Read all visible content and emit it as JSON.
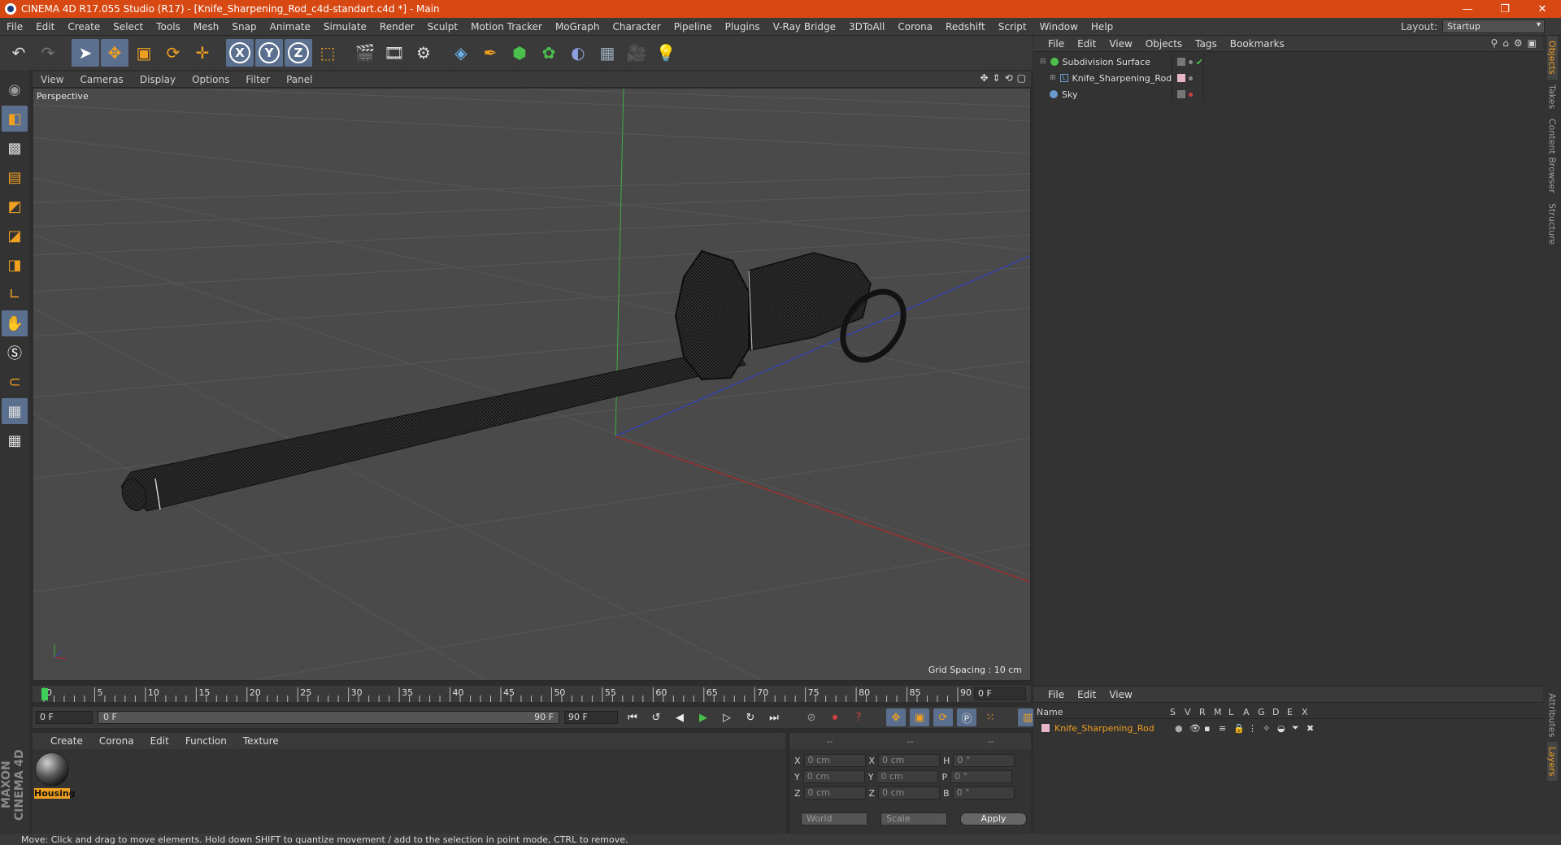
{
  "window": {
    "title": "CINEMA 4D R17.055 Studio (R17) - [Knife_Sharpening_Rod_c4d-standart.c4d *] - Main",
    "minimize": "—",
    "restore": "❐",
    "close": "✕"
  },
  "menu": {
    "items": [
      "File",
      "Edit",
      "Create",
      "Select",
      "Tools",
      "Mesh",
      "Snap",
      "Animate",
      "Simulate",
      "Render",
      "Sculpt",
      "Motion Tracker",
      "MoGraph",
      "Character",
      "Pipeline",
      "Plugins",
      "V-Ray Bridge",
      "3DToAll",
      "Corona",
      "Redshift",
      "Script",
      "Window",
      "Help"
    ],
    "layout_label": "Layout:",
    "layout_value": "Startup"
  },
  "toolbar": {
    "icons": [
      "undo-icon",
      "redo-icon",
      "select-icon",
      "move-icon",
      "scale-icon",
      "rotate-icon",
      "live-select-icon",
      "x-axis-icon",
      "y-axis-icon",
      "z-axis-icon",
      "coordinate-system-icon",
      "render-view-icon",
      "render-picture-viewer-icon",
      "edit-render-settings-icon",
      "cube-icon",
      "pen-icon",
      "subdivision-icon",
      "array-icon",
      "deformer-icon",
      "floor-icon",
      "camera-icon",
      "light-icon"
    ],
    "xyz": [
      "X",
      "Y",
      "Z"
    ]
  },
  "viewport": {
    "menu": [
      "View",
      "Cameras",
      "Display",
      "Options",
      "Filter",
      "Panel"
    ],
    "label": "Perspective",
    "grid_spacing": "Grid Spacing : 10 cm"
  },
  "objects": {
    "menu": [
      "File",
      "Edit",
      "View",
      "Objects",
      "Tags",
      "Bookmarks"
    ],
    "items": [
      {
        "name": "Subdivision Surface",
        "color": "#4cc04c"
      },
      {
        "name": "Knife_Sharpening_Rod",
        "color": "#e8b4c8"
      },
      {
        "name": "Sky",
        "color": "#6a9ad0"
      }
    ]
  },
  "side_tabs": [
    "Objects",
    "Takes",
    "Content Browser",
    "Structure",
    "Attributes",
    "Layers"
  ],
  "timeline": {
    "ticks": [
      "0",
      "5",
      "10",
      "15",
      "20",
      "25",
      "30",
      "35",
      "40",
      "45",
      "50",
      "55",
      "60",
      "65",
      "70",
      "75",
      "80",
      "85",
      "90"
    ],
    "current_frame": "0 F",
    "start_frame": "0 F",
    "slider_start": "0 F",
    "slider_end": "90 F",
    "end_frame": "90 F"
  },
  "materials": {
    "menu": [
      "Create",
      "Corona",
      "Edit",
      "Function",
      "Texture"
    ],
    "items": [
      {
        "name": "Housing"
      }
    ]
  },
  "coordinates": {
    "headers": [
      "--",
      "--",
      "--"
    ],
    "rows": [
      {
        "a": "X",
        "av": "0 cm",
        "b": "X",
        "bv": "0 cm",
        "c": "H",
        "cv": "0 °"
      },
      {
        "a": "Y",
        "av": "0 cm",
        "b": "Y",
        "bv": "0 cm",
        "c": "P",
        "cv": "0 °"
      },
      {
        "a": "Z",
        "av": "0 cm",
        "b": "Z",
        "bv": "0 cm",
        "c": "B",
        "cv": "0 °"
      }
    ],
    "space": "World",
    "mode": "Scale",
    "apply": "Apply"
  },
  "layers": {
    "menu": [
      "File",
      "Edit",
      "View"
    ],
    "columns": [
      "Name",
      "S",
      "V",
      "R",
      "M",
      "L",
      "A",
      "G",
      "D",
      "E",
      "X"
    ],
    "items": [
      {
        "name": "Knife_Sharpening_Rod"
      }
    ]
  },
  "status": "Move: Click and drag to move elements. Hold down SHIFT to quantize movement / add to the selection in point mode, CTRL to remove.",
  "brand": "MAXON CINEMA 4D",
  "colors": {
    "titlebar": "#d84813",
    "accent": "#f0a020",
    "selected_tool": "#5b6f8e"
  }
}
